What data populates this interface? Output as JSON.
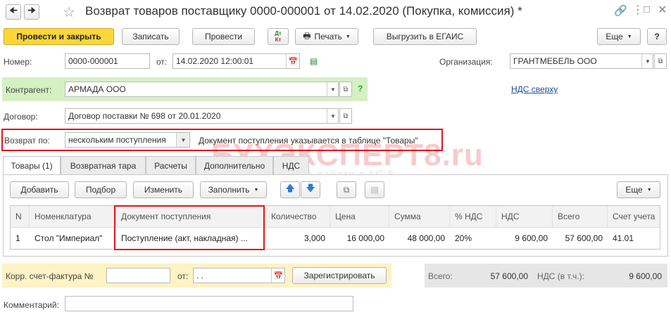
{
  "window": {
    "title": "Возврат товаров поставщику 0000-000001 от 14.02.2020 (Покупка, комиссия) *",
    "back_icon": "arrow-left-icon",
    "forward_icon": "arrow-right-icon",
    "star_icon": "star-icon",
    "link_icon": "link-icon",
    "menu_icon": "more-icon",
    "expand_icon": "expand-icon",
    "close_icon": "close-icon"
  },
  "toolbar": {
    "post_close": "Провести и закрыть",
    "write": "Записать",
    "post": "Провести",
    "dt_kt_top": "Дт",
    "dt_kt_bottom": "Кт",
    "print": "Печать",
    "export_egais": "Выгрузить в ЕГАИС",
    "more": "Еще",
    "help": "?"
  },
  "header": {
    "number_label": "Номер:",
    "number_value": "0000-000001",
    "date_label": "от:",
    "date_value": "14.02.2020 12:00:01",
    "org_label": "Организация:",
    "org_value": "ГРАНТМЕБЕЛЬ ООО",
    "counterparty_label": "Контрагент:",
    "counterparty_value": "АРМАДА ООО",
    "help_q": "?",
    "vat_link": "НДС сверху",
    "contract_label": "Договор:",
    "contract_value": "Договор поставки № 698 от 20.01.2020",
    "return_label": "Возврат по:",
    "return_value": "нескольким поступления",
    "return_hint": "Документ поступления указывается в таблице \"Товары\""
  },
  "watermark": {
    "brand": "БУХЭКСПЕРТ8.ru",
    "tagline": "Онлайн-курсы по работе в 1С:8"
  },
  "tabs": [
    "Товары (1)",
    "Возвратная тара",
    "Расчеты",
    "Дополнительно",
    "НДС"
  ],
  "table_toolbar": {
    "add": "Добавить",
    "select": "Подбор",
    "edit": "Изменить",
    "fill": "Заполнить",
    "more": "Еще"
  },
  "table": {
    "headers": [
      "N",
      "Номенклатура",
      "Документ поступления",
      "Количество",
      "Цена",
      "Сумма",
      "% НДС",
      "НДС",
      "Всего",
      "Счет учета"
    ],
    "rows": [
      [
        "1",
        "Стол \"Империал\"",
        "Поступление (акт, накладная) ...",
        "3,000",
        "16 000,00",
        "48 000,00",
        "20%",
        "9 600,00",
        "57 600,00",
        "41.01"
      ]
    ]
  },
  "footer": {
    "invoice_label": "Корр. счет-фактура №",
    "invoice_value": "",
    "invoice_date_label": "от:",
    "invoice_date_value": " .  .",
    "register": "Зарегистрировать",
    "total_label": "Всего:",
    "total_value": "57 600,00",
    "vat_label": "НДС (в т.ч.):",
    "vat_value": "9 600,00",
    "comment_label": "Комментарий:",
    "comment_value": ""
  },
  "colors": {
    "accent": "#fbd63a",
    "highlight_green": "#d5f0c3",
    "highlight_yellow": "#fdf3c4",
    "red_outline": "#e0151c",
    "link": "#1a4d9e"
  }
}
